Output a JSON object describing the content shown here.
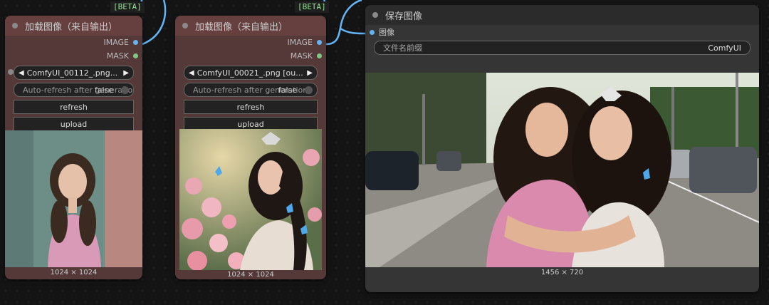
{
  "nodes": {
    "load1": {
      "badge": "[BETA]",
      "title": "加载图像（来自输出）",
      "outputs": [
        "IMAGE",
        "MASK"
      ],
      "file": "ComfyUI_00112_.png...",
      "toggle_label": "Auto-refresh after generation",
      "toggle_value": "false",
      "refresh_label": "refresh",
      "upload_label": "upload",
      "dimensions": "1024 × 1024"
    },
    "load2": {
      "badge": "[BETA]",
      "title": "加载图像（来自输出）",
      "outputs": [
        "IMAGE",
        "MASK"
      ],
      "file": "ComfyUI_00021_.png [ou...",
      "toggle_label": "Auto-refresh after generation",
      "toggle_value": "false",
      "refresh_label": "refresh",
      "upload_label": "upload",
      "dimensions": "1024 × 1024"
    },
    "save": {
      "title": "保存图像",
      "input_label": "图像",
      "prefix_label": "文件名前缀",
      "prefix_value": "ComfyUI",
      "dimensions": "1456 × 720"
    }
  },
  "colors": {
    "image_slot": "#64b5f6",
    "mask_slot": "#81c784",
    "load_node_bg": "#553838",
    "save_node_bg": "#353535"
  }
}
